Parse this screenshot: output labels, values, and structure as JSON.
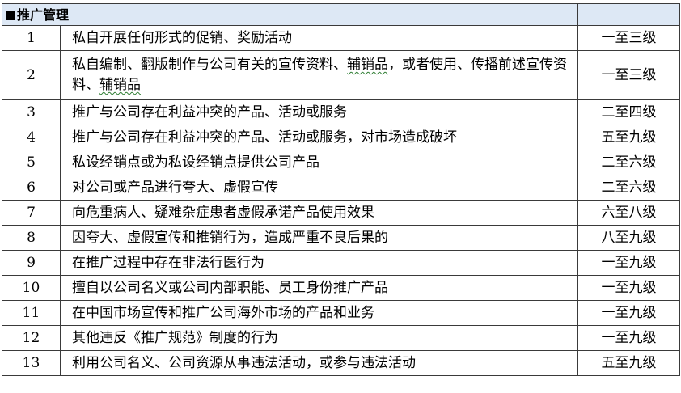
{
  "section": {
    "icon": "black-square",
    "title": "推广管理"
  },
  "rows": [
    {
      "num": "1",
      "desc": "私自开展任何形式的促销、奖励活动",
      "level": "一至三级"
    },
    {
      "num": "2",
      "desc_a": "私自编制、翻版制作与公司有关的宣传资料、",
      "desc_b": "辅销品",
      "desc_c": "，或者使用、传播前述宣传资料、",
      "desc_d": "辅销品",
      "level": "一至三级"
    },
    {
      "num": "3",
      "desc": "推广与公司存在利益冲突的产品、活动或服务",
      "level": "二至四级"
    },
    {
      "num": "4",
      "desc": "推广与公司存在利益冲突的产品、活动或服务，对市场造成破坏",
      "level": "五至九级"
    },
    {
      "num": "5",
      "desc": "私设经销点或为私设经销点提供公司产品",
      "level": "二至六级"
    },
    {
      "num": "6",
      "desc": "对公司或产品进行夸大、虚假宣传",
      "level": "二至六级"
    },
    {
      "num": "7",
      "desc": "向危重病人、疑难杂症患者虚假承诺产品使用效果",
      "level": "六至八级"
    },
    {
      "num": "8",
      "desc": "因夸大、虚假宣传和推销行为，造成严重不良后果的",
      "level": "八至九级"
    },
    {
      "num": "9",
      "desc": "在推广过程中存在非法行医行为",
      "level": "一至九级"
    },
    {
      "num": "10",
      "desc": "擅自以公司名义或公司内部职能、员工身份推广产品",
      "level": "一至九级"
    },
    {
      "num": "11",
      "desc": "在中国市场宣传和推广公司海外市场的产品和业务",
      "level": "一至九级"
    },
    {
      "num": "12",
      "desc": "其他违反《推广规范》制度的行为",
      "level": "一至九级"
    },
    {
      "num": "13",
      "desc": "利用公司名义、公司资源从事违法活动，或参与违法活动",
      "level": "五至九级"
    }
  ]
}
